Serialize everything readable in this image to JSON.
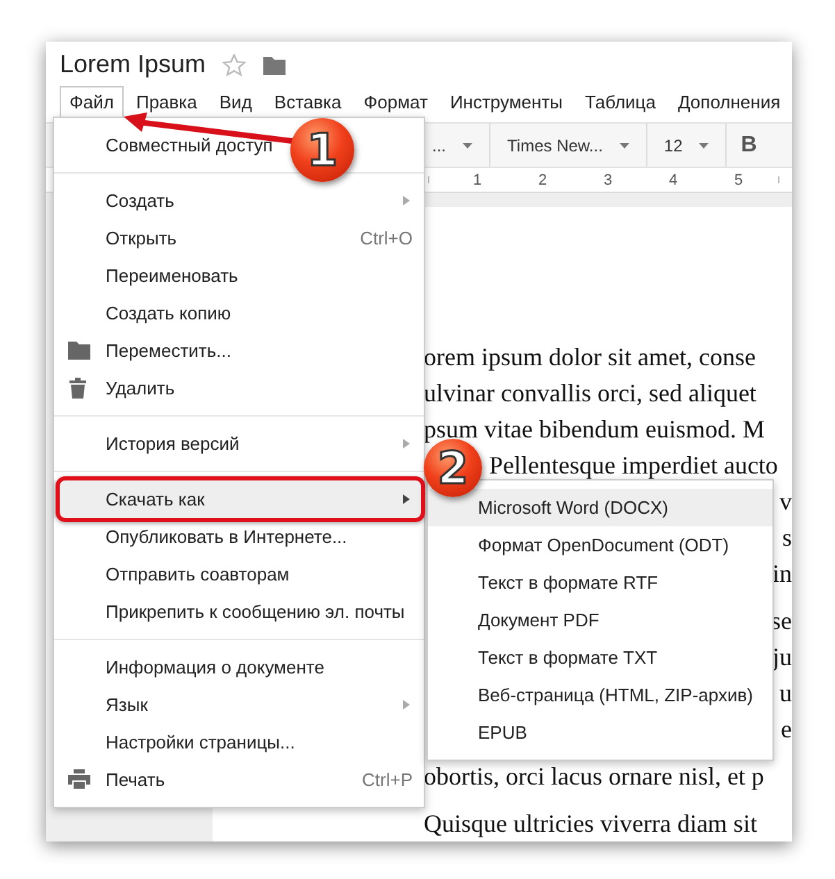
{
  "window": {
    "title": "Lorem Ipsum"
  },
  "menubar": [
    {
      "label": "Файл",
      "selected": true
    },
    {
      "label": "Правка",
      "selected": false
    },
    {
      "label": "Вид",
      "selected": false
    },
    {
      "label": "Вставка",
      "selected": false
    },
    {
      "label": "Формат",
      "selected": false
    },
    {
      "label": "Инструменты",
      "selected": false
    },
    {
      "label": "Таблица",
      "selected": false
    },
    {
      "label": "Дополнения",
      "selected": false
    }
  ],
  "toolbar": [
    {
      "kind": "dropdown",
      "label": "..."
    },
    {
      "kind": "dropdown",
      "label": "Times New..."
    },
    {
      "kind": "dropdown",
      "label": "12"
    },
    {
      "kind": "button",
      "label": "B"
    }
  ],
  "ruler": [
    "1",
    "2",
    "3",
    "4",
    "5"
  ],
  "document": [
    {
      "kind": "line",
      "text": "orem ipsum dolor sit amet, conse"
    },
    {
      "kind": "line",
      "text": "ulvinar convallis orci, sed aliquet"
    },
    {
      "kind": "line",
      "text": "psum vitae bibendum euismod. M"
    },
    {
      "kind": "indent",
      "text": "Pellentesque imperdiet aucto"
    },
    {
      "kind": "clipped",
      "text": "v"
    },
    {
      "kind": "clipped",
      "text": "s"
    },
    {
      "kind": "clipped",
      "text": "in"
    },
    {
      "kind": "clipped-para",
      "text": "se"
    },
    {
      "kind": "clipped",
      "text": "ju"
    },
    {
      "kind": "clipped",
      "text": "u"
    },
    {
      "kind": "clipped",
      "text": "e"
    },
    {
      "kind": "gap",
      "text": "obortis, orci lacus ornare nisl, et p"
    },
    {
      "kind": "gap",
      "text": "Quisque ultricies viverra diam sit"
    }
  ],
  "file_menu": [
    [
      {
        "label": "Совместный доступ",
        "submenu": false,
        "highlighted": false
      }
    ],
    [
      {
        "label": "Создать",
        "submenu": true,
        "highlighted": false
      },
      {
        "label": "Открыть",
        "shortcut": "Ctrl+O",
        "submenu": false,
        "highlighted": false
      },
      {
        "label": "Переименовать",
        "submenu": false,
        "highlighted": false
      },
      {
        "label": "Создать копию",
        "submenu": false,
        "highlighted": false
      },
      {
        "label": "Переместить...",
        "submenu": false,
        "highlighted": false
      },
      {
        "label": "Удалить",
        "submenu": false,
        "highlighted": false
      }
    ],
    [
      {
        "label": "История версий",
        "submenu": true,
        "highlighted": false
      }
    ],
    [
      {
        "label": "Скачать как",
        "submenu": true,
        "highlighted": true
      },
      {
        "label": "Опубликовать в Интернете...",
        "submenu": false,
        "highlighted": false
      },
      {
        "label": "Отправить соавторам",
        "submenu": false,
        "highlighted": false
      },
      {
        "label": "Прикрепить к сообщению эл. почты",
        "submenu": false,
        "highlighted": false
      }
    ],
    [
      {
        "label": "Информация о документе",
        "submenu": false,
        "highlighted": false
      },
      {
        "label": "Язык",
        "submenu": true,
        "highlighted": false
      },
      {
        "label": "Настройки страницы...",
        "submenu": false,
        "highlighted": false
      },
      {
        "label": "Печать",
        "shortcut": "Ctrl+P",
        "submenu": false,
        "highlighted": false
      }
    ]
  ],
  "download_submenu": [
    {
      "label": "Microsoft Word (DOCX)",
      "highlighted": true
    },
    {
      "label": "Формат OpenDocument (ODT)",
      "highlighted": false
    },
    {
      "label": "Текст в формате RTF",
      "highlighted": false
    },
    {
      "label": "Документ PDF",
      "highlighted": false
    },
    {
      "label": "Текст в формате TXT",
      "highlighted": false
    },
    {
      "label": "Веб-страница (HTML, ZIP-архив)",
      "highlighted": false
    },
    {
      "label": "EPUB",
      "highlighted": false
    }
  ],
  "annotations": [
    {
      "label": "1"
    },
    {
      "label": "2"
    }
  ]
}
